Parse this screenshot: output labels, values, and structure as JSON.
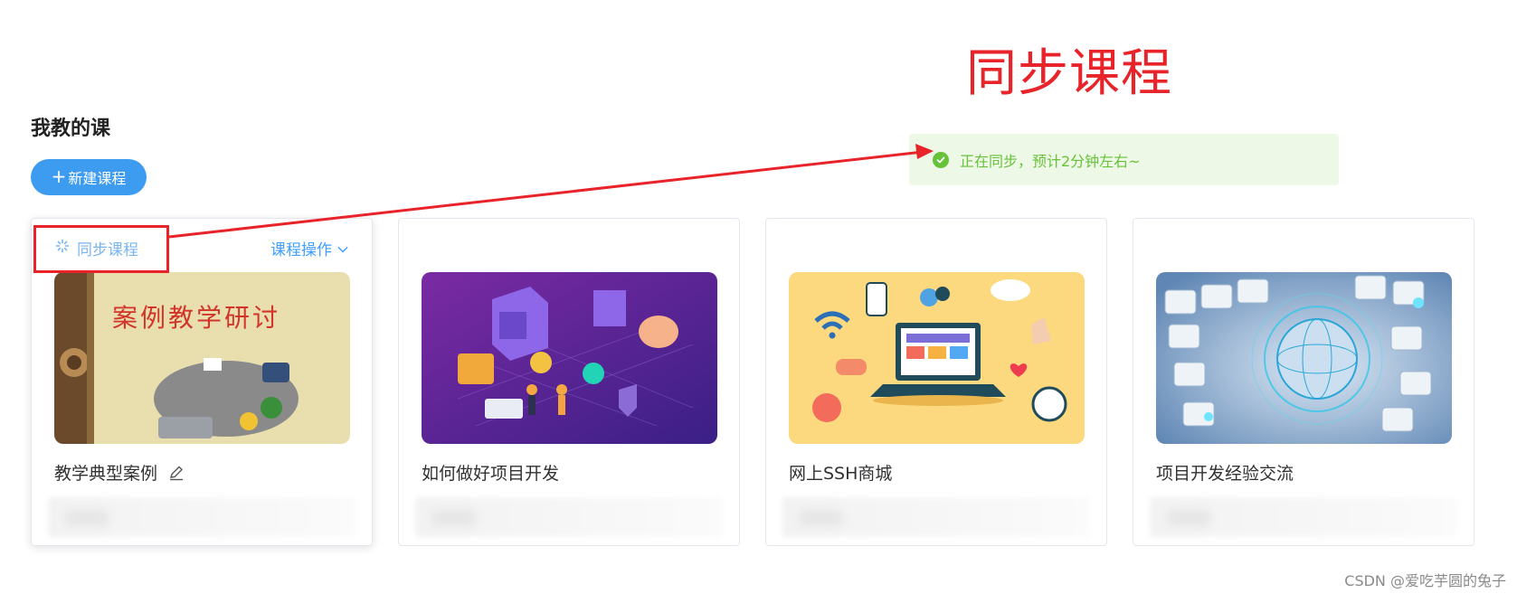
{
  "annotation": {
    "title": "同步课程",
    "color": "#e8232a"
  },
  "page": {
    "title": "我教的课"
  },
  "toolbar": {
    "new_course_plus": "+",
    "new_course_label": "新建课程"
  },
  "toast": {
    "message": "正在同步，预计2分钟左右~",
    "status": "success",
    "color": "#67c23a"
  },
  "course_card_actions": {
    "sync_label": "同步课程",
    "operations_label": "课程操作"
  },
  "courses": [
    {
      "name": "教学典型案例",
      "cover_text": "案例教学研讨",
      "editable": true,
      "cover_theme": "case-study-meeting"
    },
    {
      "name": "如何做好项目开发",
      "editable": false,
      "cover_theme": "isometric-finance-atm"
    },
    {
      "name": "网上SSH商城",
      "editable": false,
      "cover_theme": "laptop-online-shopping"
    },
    {
      "name": "项目开发经验交流",
      "editable": false,
      "cover_theme": "keyboard-data-globe"
    }
  ],
  "watermark": "CSDN @爱吃芋圆的兔子",
  "colors": {
    "primary": "#409eff",
    "button_bg": "#3d9bf0",
    "border": "#e4e7ed"
  }
}
